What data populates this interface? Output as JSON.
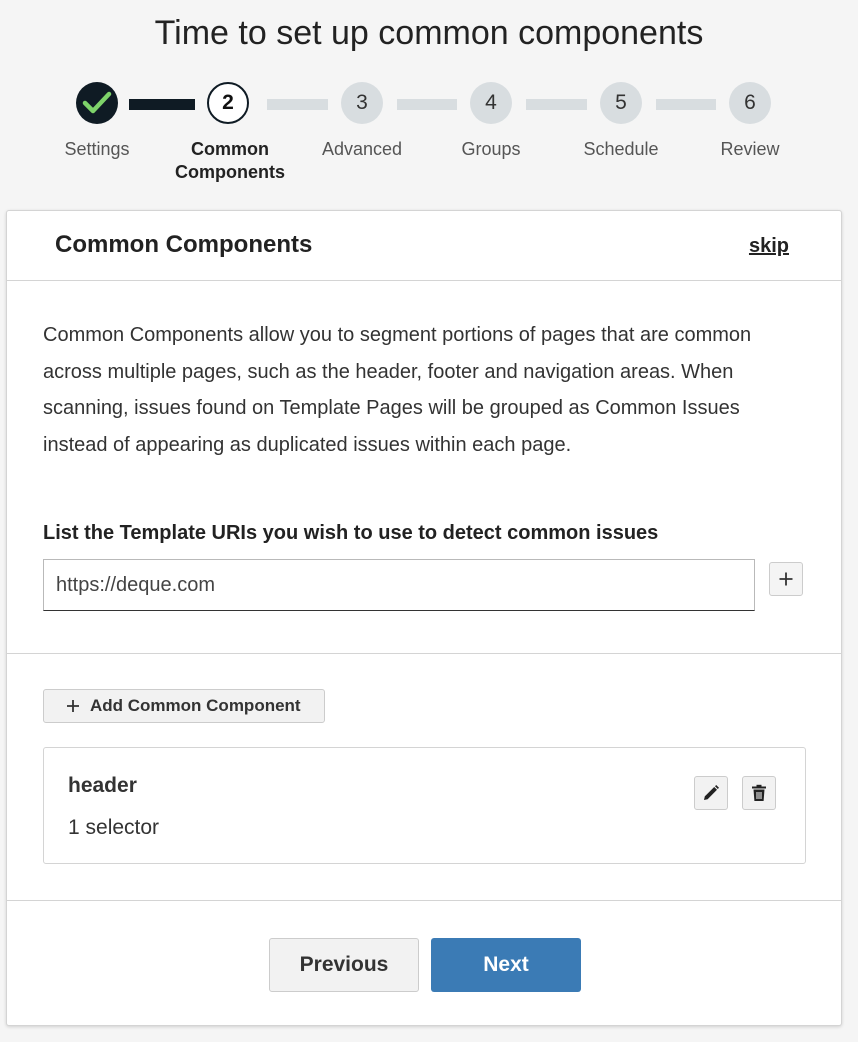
{
  "page_title": "Time to set up common components",
  "stepper": {
    "steps": [
      {
        "number": "",
        "label_line1": "Settings",
        "label_line2": "",
        "state": "complete",
        "icon": "check-icon"
      },
      {
        "number": "2",
        "label_line1": "Common",
        "label_line2": "Components",
        "state": "current"
      },
      {
        "number": "3",
        "label_line1": "Advanced",
        "label_line2": "",
        "state": "upcoming"
      },
      {
        "number": "4",
        "label_line1": "Groups",
        "label_line2": "",
        "state": "upcoming"
      },
      {
        "number": "5",
        "label_line1": "Schedule",
        "label_line2": "",
        "state": "upcoming"
      },
      {
        "number": "6",
        "label_line1": "Review",
        "label_line2": "",
        "state": "upcoming"
      }
    ]
  },
  "card": {
    "title": "Common Components",
    "skip_label": "skip",
    "description": "Common Components allow you to segment portions of pages that are common across multiple pages, such as the header, footer and navigation areas. When scanning, issues found on Template Pages will be grouped as Common Issues instead of appearing as duplicated issues within each page.",
    "uri_label": "List the Template URIs you wish to use to detect common issues",
    "uri_value": "https://deque.com",
    "add_uri_icon": "plus-icon",
    "add_component_label": "Add Common Component",
    "components": [
      {
        "name": "header",
        "count": "1 selector",
        "edit_icon": "pencil-icon",
        "delete_icon": "trash-icon"
      }
    ]
  },
  "footer": {
    "previous_label": "Previous",
    "next_label": "Next"
  },
  "colors": {
    "accent_dark": "#0f1b24",
    "check_green": "#7ed36a",
    "step_inactive": "#d8dde0",
    "primary_button": "#3b7bb5"
  }
}
